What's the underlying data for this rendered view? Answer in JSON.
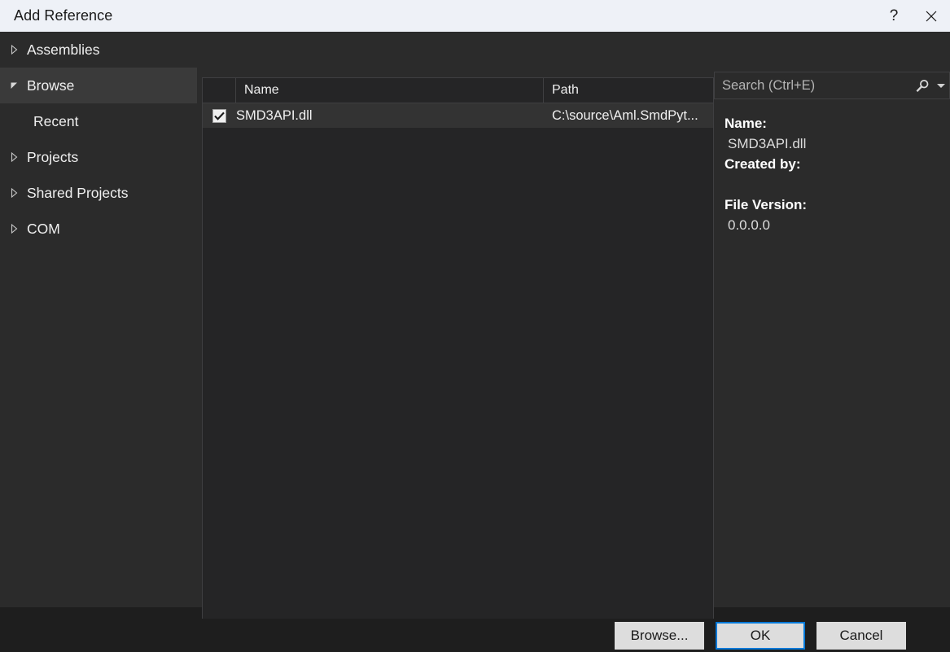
{
  "window": {
    "title": "Add Reference",
    "help_label": "?",
    "close_label": "✕"
  },
  "sidebar": {
    "items": [
      {
        "label": "Assemblies",
        "state": "collapsed",
        "level": 0,
        "selected": false
      },
      {
        "label": "Browse",
        "state": "expanded",
        "level": 0,
        "selected": true
      },
      {
        "label": "Recent",
        "state": "leaf",
        "level": 1,
        "selected": false
      },
      {
        "label": "Projects",
        "state": "collapsed",
        "level": 0,
        "selected": false
      },
      {
        "label": "Shared Projects",
        "state": "collapsed",
        "level": 0,
        "selected": false
      },
      {
        "label": "COM",
        "state": "collapsed",
        "level": 0,
        "selected": false
      }
    ]
  },
  "search": {
    "placeholder": "Search (Ctrl+E)",
    "value": "",
    "icon": "search-icon",
    "dropdown_icon": "chevron-down-icon"
  },
  "list": {
    "columns": [
      {
        "key": "check",
        "label": ""
      },
      {
        "key": "name",
        "label": "Name"
      },
      {
        "key": "path",
        "label": "Path"
      }
    ],
    "rows": [
      {
        "checked": true,
        "name": "SMD3API.dll",
        "path": "C:\\source\\Aml.SmdPyt...",
        "selected": true
      }
    ]
  },
  "details": {
    "name_key": "Name:",
    "name_value": "SMD3API.dll",
    "created_by_key": "Created by:",
    "created_by_value": "",
    "file_version_key": "File Version:",
    "file_version_value": "0.0.0.0"
  },
  "footer": {
    "browse_label": "Browse...",
    "ok_label": "OK",
    "cancel_label": "Cancel"
  },
  "colors": {
    "titlebar_bg": "#eef1f7",
    "dialog_bg": "#2b2b2b",
    "footer_bg": "#1e1e1e",
    "list_bg": "#252526",
    "row_selected_bg": "#333333",
    "accent_focus": "#0078d7",
    "button_bg": "#dddddd",
    "text": "#f0f0f0"
  }
}
